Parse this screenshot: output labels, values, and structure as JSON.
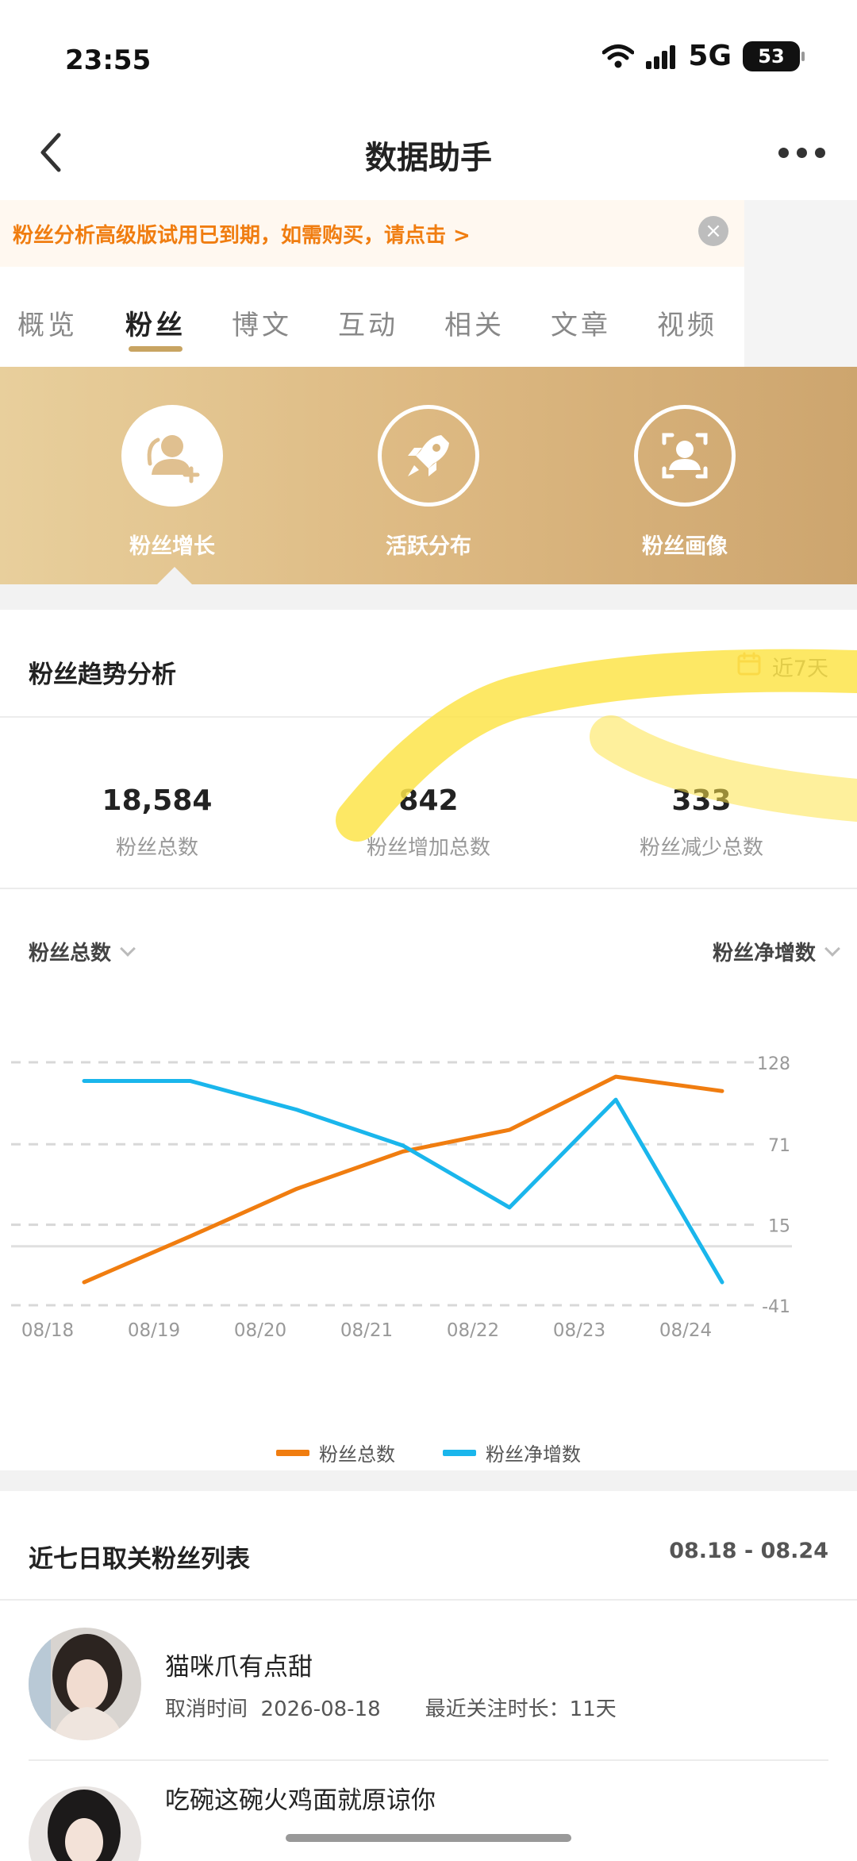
{
  "status_bar": {
    "time": "23:55",
    "network": "5G",
    "battery": "53"
  },
  "nav": {
    "title": "数据助手"
  },
  "banner": {
    "text": "粉丝分析高级版试用已到期，如需购买，请点击  >"
  },
  "tabs": [
    {
      "label": "概览"
    },
    {
      "label": "粉丝"
    },
    {
      "label": "博文"
    },
    {
      "label": "互动"
    },
    {
      "label": "相关"
    },
    {
      "label": "文章"
    },
    {
      "label": "视频"
    }
  ],
  "active_tab": "粉丝",
  "hero": {
    "items": [
      {
        "label": "粉丝增长",
        "icon": "user-add-icon"
      },
      {
        "label": "活跃分布",
        "icon": "rocket-icon"
      },
      {
        "label": "粉丝画像",
        "icon": "user-portrait-icon"
      }
    ]
  },
  "trend": {
    "title": "粉丝趋势分析",
    "range": "近7天",
    "stats": [
      {
        "value": "18,584",
        "label": "粉丝总数"
      },
      {
        "value": "842",
        "label": "粉丝增加总数"
      },
      {
        "value": "333",
        "label": "粉丝减少总数"
      }
    ],
    "left_metric": "粉丝总数",
    "right_metric": "粉丝净增数"
  },
  "chart_data": {
    "type": "line",
    "categories": [
      "08/18",
      "08/19",
      "08/20",
      "08/21",
      "08/22",
      "08/23",
      "08/24"
    ],
    "y_ticks": [
      "128",
      "71",
      "15",
      "-41"
    ],
    "ylim": [
      -41,
      128
    ],
    "series": [
      {
        "name": "粉丝总数",
        "color": "#f07d10",
        "values": [
          -25,
          7,
          40,
          66,
          81,
          118,
          108
        ]
      },
      {
        "name": "粉丝净增数",
        "color": "#1ab6ec",
        "values": [
          115,
          115,
          95,
          70,
          27,
          102,
          -25
        ]
      }
    ],
    "grid": true,
    "legend": "bottom-center"
  },
  "unfollow_list": {
    "title": "近七日取关粉丝列表",
    "range": "08.18  -  08.24",
    "items": [
      {
        "name": "猫咪爪有点甜",
        "cancel_label": "取消时间",
        "cancel_date": "2026-08-18",
        "duration_label": "最近关注时长：",
        "duration": "11天"
      },
      {
        "name": "吃碗这碗火鸡面就原谅你"
      }
    ]
  },
  "colors": {
    "accent_orange": "#f07d10",
    "accent_blue": "#1ab6ec",
    "gold": "#c8a462"
  }
}
